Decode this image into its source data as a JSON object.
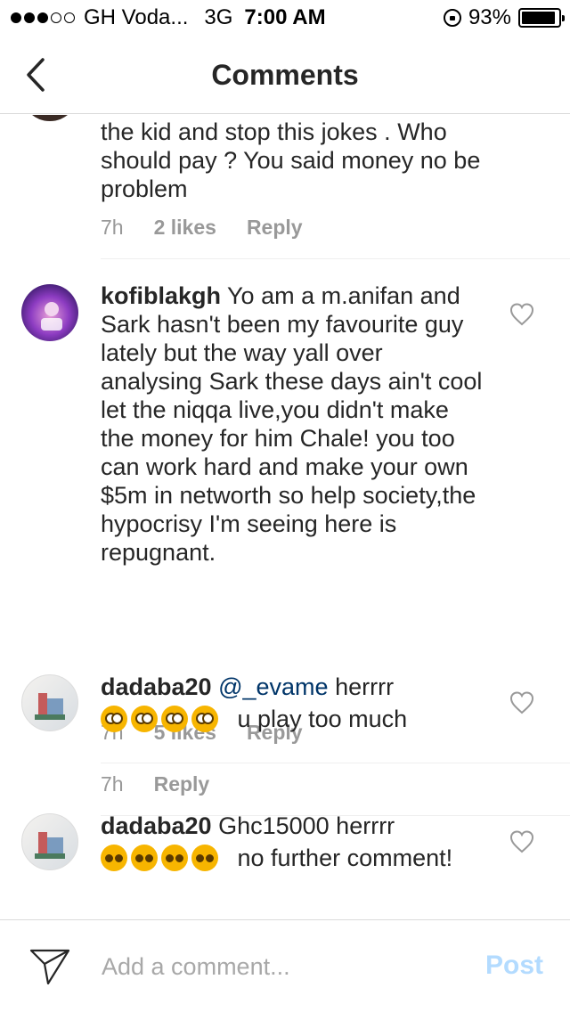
{
  "status_bar": {
    "carrier": "GH Voda...",
    "network": "3G",
    "time": "7:00 AM",
    "battery": "93%",
    "battery_level": 0.93
  },
  "header": {
    "title": "Comments"
  },
  "comments": [
    {
      "username": "",
      "text": "the kid and stop this jokes . Who should pay ? You said money no be problem",
      "time": "7h",
      "likes": "2 likes",
      "reply": "Reply"
    },
    {
      "username": "kofiblakgh",
      "text": "Yo am a m.anifan and Sark hasn't been my favourite guy lately but the way yall over analysing Sark these days ain't cool let the niqqa live,you didn't make the money for him Chale! you too can work hard and make your own $5m in networth so help society,the hypocrisy I'm seeing here is repugnant.",
      "time": "7h",
      "likes": "5 likes",
      "reply": "Reply"
    },
    {
      "username": "dadaba20",
      "mention": "@_evame",
      "text": "herrrr",
      "text2": "u play too much",
      "emojis": [
        "flushed-emoji",
        "flushed-emoji",
        "flushed-emoji",
        "flushed-emoji"
      ],
      "time": "7h",
      "reply": "Reply"
    },
    {
      "username": "dadaba20",
      "text": "Ghc15000  herrrr",
      "text2": "no further comment!",
      "emojis": [
        "sad-emoji",
        "sad-emoji",
        "sad-emoji",
        "sad-emoji"
      ]
    }
  ],
  "composer": {
    "placeholder": "Add a comment...",
    "post_label": "Post"
  },
  "colors": {
    "mention": "#003569",
    "meta": "#999999",
    "post_disabled": "#b3dbff"
  }
}
